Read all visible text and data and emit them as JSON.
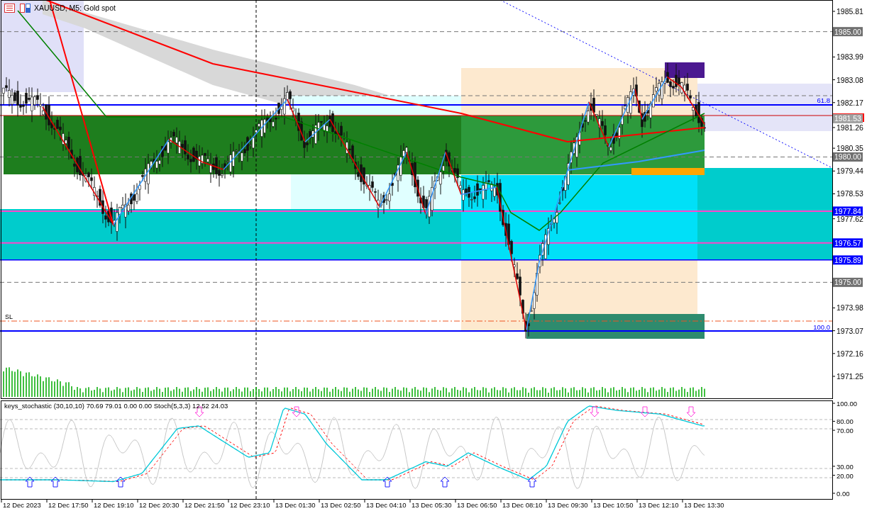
{
  "chart": {
    "title": "XAUUSD, M5:  Gold spot",
    "price_ticks": [
      "1985.81",
      "1983.99",
      "1983.08",
      "1982.17",
      "1981.26",
      "1980.35",
      "1979.44",
      "1978.53",
      "1977.62",
      "1973.98",
      "1973.07",
      "1972.16",
      "1971.25"
    ],
    "price_tags": [
      {
        "label": "1985.00",
        "color": "#707070"
      },
      {
        "label": "1981.53",
        "color": "#a0a0a0"
      },
      {
        "label": "1980.00",
        "color": "#707070"
      },
      {
        "label": "1977.84",
        "color": "#0000ff"
      },
      {
        "label": "1976.57",
        "color": "#0000ff"
      },
      {
        "label": "1975.89",
        "color": "#0000ff"
      },
      {
        "label": "1975.00",
        "color": "#707070"
      }
    ],
    "fib_labels": [
      "61.8",
      "100.0"
    ],
    "stop_loss_label": "SL"
  },
  "indicator": {
    "label": "keys_stochastic (30,10,10) 70.69 79.01 0.00 0.00 Stoch(5,3,3) 12.52 24.03",
    "ticks": [
      "100.00",
      "80.00",
      "70.00",
      "30.00",
      "20.00",
      "0.00"
    ]
  },
  "time_axis": [
    "12 Dec 2023",
    "12 Dec 17:50",
    "12 Dec 19:10",
    "12 Dec 20:30",
    "12 Dec 21:50",
    "12 Dec 23:10",
    "13 Dec 01:30",
    "13 Dec 02:50",
    "13 Dec 04:10",
    "13 Dec 05:30",
    "13 Dec 06:50",
    "13 Dec 08:10",
    "13 Dec 09:30",
    "13 Dec 10:50",
    "13 Dec 12:10",
    "13 Dec 13:30"
  ]
}
